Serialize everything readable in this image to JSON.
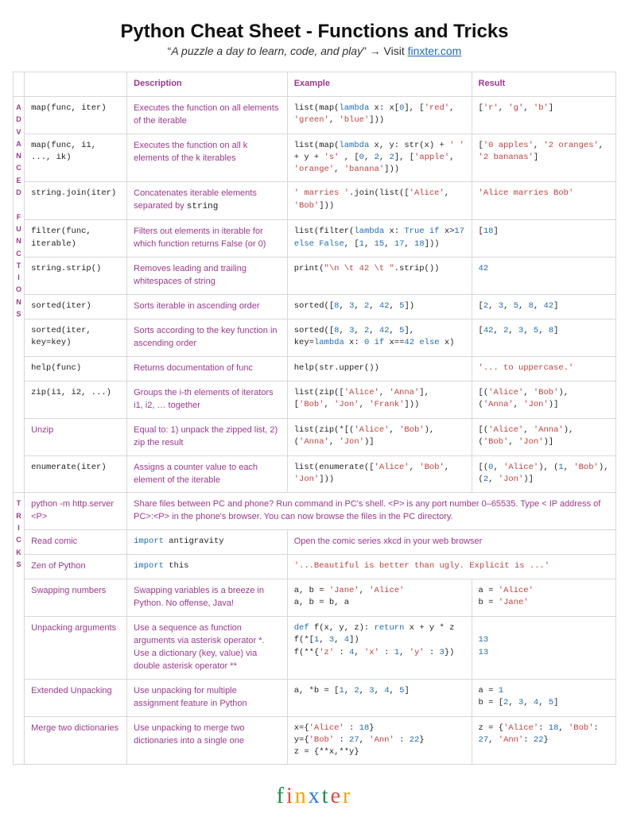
{
  "header": {
    "title": "Python Cheat Sheet - Functions and Tricks",
    "tagline_quote": "A puzzle a day to learn, code, and play",
    "visit_label": "Visit",
    "link_text": "finxter.com"
  },
  "columns": {
    "description": "Description",
    "example": "Example",
    "result": "Result"
  },
  "sections": [
    {
      "label": "A\nD\nV\nA\nN\nC\nE\nD\n \nF\nU\nN\nC\nT\nI\nO\nN\nS"
    },
    {
      "label": "T\nR\nI\nC\nK\nS"
    }
  ],
  "adv": [
    {
      "name": "map(func, iter)",
      "desc": "Executes the function on all elements of the iterable",
      "example_html": "list(map(<span class='k'>lambda</span> x: x[<span class='n'>0</span>], [<span class='s'>'red'</span>, <span class='s'>'green'</span>, <span class='s'>'blue'</span>]))",
      "result_html": " [<span class='s'>'r'</span>, <span class='s'>'g'</span>, <span class='s'>'b'</span>]"
    },
    {
      "name": "map(func, i1, ..., ik)",
      "desc": "Executes the function on all k elements of the k iterables",
      "example_html": "list(map(<span class='k'>lambda</span> x, y: str(x) + <span class='s'>' '</span> + y + <span class='s'>'s'</span> , [<span class='n'>0</span>, <span class='n'>2</span>, <span class='n'>2</span>], [<span class='s'>'apple'</span>, <span class='s'>'orange'</span>, <span class='s'>'banana'</span>]))",
      "result_html": "[<span class='s'>'0 apples'</span>, <span class='s'>'2 oranges'</span>, <span class='s'>'2 bananas'</span>]"
    },
    {
      "name": "string.join(iter)",
      "desc_html": "Concatenates iterable elements separated by <span class='kw'>string</span>",
      "example_html": "<span class='s'>' marries '</span>.join(list([<span class='s'>'Alice'</span>, <span class='s'>'Bob'</span>]))",
      "result_html": "<span class='s'>'Alice marries Bob'</span>"
    },
    {
      "name": "filter(func, iterable)",
      "desc": "Filters out elements in iterable for which function returns False (or 0)",
      "example_html": "list(filter(<span class='k'>lambda</span> x: <span class='k'>True</span> <span class='k'>if</span> x&gt;<span class='n'>17</span> <span class='k'>else</span> <span class='k'>False</span>, [<span class='n'>1</span>, <span class='n'>15</span>, <span class='n'>17</span>, <span class='n'>18</span>]))",
      "result_html": "[<span class='n'>18</span>]"
    },
    {
      "name": "string.strip()",
      "desc": "Removes leading and trailing whitespaces of string",
      "example_html": "print(<span class='s'>\"\\n   \\t  42  \\t \"</span>.strip())",
      "result_html": "<span class='n'>42</span>"
    },
    {
      "name": "sorted(iter)",
      "desc": "Sorts iterable in ascending order",
      "example_html": "sorted([<span class='n'>8</span>, <span class='n'>3</span>, <span class='n'>2</span>, <span class='n'>42</span>, <span class='n'>5</span>])",
      "result_html": "[<span class='n'>2</span>, <span class='n'>3</span>, <span class='n'>5</span>, <span class='n'>8</span>, <span class='n'>42</span>]"
    },
    {
      "name": "sorted(iter, key=key)",
      "desc": "Sorts according to the key function in ascending order",
      "example_html": "sorted([<span class='n'>8</span>, <span class='n'>3</span>, <span class='n'>2</span>, <span class='n'>42</span>, <span class='n'>5</span>], key=<span class='k'>lambda</span> x: <span class='n'>0</span> <span class='k'>if</span> x==<span class='n'>42</span> <span class='k'>else</span> x)",
      "result_html": "[<span class='n'>42</span>, <span class='n'>2</span>, <span class='n'>3</span>, <span class='n'>5</span>, <span class='n'>8</span>]"
    },
    {
      "name": "help(func)",
      "desc": "Returns documentation of func",
      "example_html": "help(str.upper())",
      "result_html": "<span class='s'>'... to uppercase.'</span>"
    },
    {
      "name": "zip(i1, i2, ...)",
      "desc": "Groups the i-th elements of iterators i1, i2, … together",
      "example_html": "list(zip([<span class='s'>'Alice'</span>, <span class='s'>'Anna'</span>], [<span class='s'>'Bob'</span>, <span class='s'>'Jon'</span>, <span class='s'>'Frank'</span>]))",
      "result_html": "[(<span class='s'>'Alice'</span>, <span class='s'>'Bob'</span>), (<span class='s'>'Anna'</span>, <span class='s'>'Jon'</span>)]"
    },
    {
      "name_alt": "Unzip",
      "desc": "Equal to: 1) unpack the zipped list, 2) zip the result",
      "example_html": "list(zip(*[(<span class='s'>'Alice'</span>, <span class='s'>'Bob'</span>), (<span class='s'>'Anna'</span>, <span class='s'>'Jon'</span>)]",
      "result_html": "[(<span class='s'>'Alice'</span>, <span class='s'>'Anna'</span>), (<span class='s'>'Bob'</span>, <span class='s'>'Jon'</span>)]"
    },
    {
      "name": "enumerate(iter)",
      "desc": "Assigns a counter value to each element of the iterable",
      "example_html": "list(enumerate([<span class='s'>'Alice'</span>, <span class='s'>'Bob'</span>, <span class='s'>'Jon'</span>]))",
      "result_html": "[(<span class='n'>0</span>, <span class='s'>'Alice'</span>), (<span class='n'>1</span>, <span class='s'>'Bob'</span>), (<span class='n'>2</span>, <span class='s'>'Jon'</span>)]"
    }
  ],
  "tricks": [
    {
      "name_html": "python -m http.server &lt;P&gt;",
      "full_span": true,
      "desc": "Share files between PC and phone? Run command in PC's shell. <P> is any port number 0–65535. Type < IP address of PC>:<P> in the phone's browser. You can now browse the files in the PC directory."
    },
    {
      "name_alt": "Read comic",
      "desc_mono_html": "<span class='k'>import</span> antigravity",
      "ex_res_span": "Open the comic series xkcd in your web browser"
    },
    {
      "name_alt": "Zen of Python",
      "desc_mono_html": "<span class='k'>import</span> this",
      "ex_res_mono_html": "<span class='s'>'...Beautiful is better than ugly. Explicit is ...'</span>"
    },
    {
      "name_alt": "Swapping numbers",
      "desc": "Swapping variables is a breeze in Python. No offense, Java!",
      "example_html": "a, b = <span class='s'>'Jane'</span>, <span class='s'>'Alice'</span><br>a, b = b, a",
      "result_html": "a = <span class='s'>'Alice'</span><br>b = <span class='s'>'Jane'</span>"
    },
    {
      "name_alt": "Unpacking arguments",
      "desc": "Use a sequence as function arguments via asterisk operator *. Use a dictionary (key, value) via double asterisk operator **",
      "example_html": "<span class='k'>def</span> f(x, y, z): <span class='k'>return</span> x + y * z<br>f(*[<span class='n'>1</span>, <span class='n'>3</span>, <span class='n'>4</span>])<br>f(**{<span class='s'>'z'</span> : <span class='n'>4</span>, <span class='s'>'x'</span> : <span class='n'>1</span>, <span class='s'>'y'</span> : <span class='n'>3</span>})",
      "result_html": "<br><span class='n'>13</span><br><span class='n'>13</span>"
    },
    {
      "name_alt": "Extended Unpacking",
      "desc": "Use unpacking for multiple assignment feature in Python",
      "example_html": "a, *b = [<span class='n'>1</span>, <span class='n'>2</span>, <span class='n'>3</span>, <span class='n'>4</span>, <span class='n'>5</span>]",
      "result_html": "a = <span class='n'>1</span><br>b = [<span class='n'>2</span>, <span class='n'>3</span>, <span class='n'>4</span>, <span class='n'>5</span>]"
    },
    {
      "name_alt": "Merge two dictionaries",
      "desc": "Use unpacking to merge two dictionaries into a single one",
      "example_html": "x={<span class='s'>'Alice'</span> : <span class='n'>18</span>}<br>y={<span class='s'>'Bob'</span> : <span class='n'>27</span>, <span class='s'>'Ann'</span> : <span class='n'>22</span>}<br>z = {**x,**y}",
      "result_html": "z = {<span class='s'>'Alice'</span>: <span class='n'>18</span>, <span class='s'>'Bob'</span>: <span class='n'>27</span>, <span class='s'>'Ann'</span>: <span class='n'>22</span>}"
    }
  ],
  "footer": {
    "brand": "finxter"
  }
}
